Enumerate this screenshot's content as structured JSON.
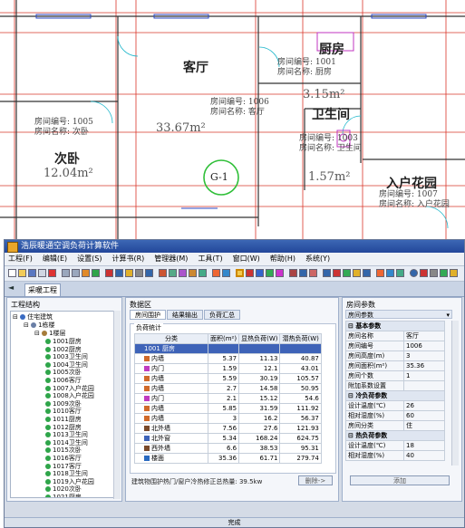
{
  "cad": {
    "rooms": [
      {
        "name": "客厅",
        "area": "33.67m²",
        "number_label": "房间编号: 1006",
        "name_label": "房间名称: 客厅"
      },
      {
        "name": "厨房",
        "number_label": "房间编号: 1001",
        "name_label": "房间名称: 厨房"
      },
      {
        "name": "卫生间",
        "area": "3.15m²",
        "number_label": "房间编号: 1003",
        "name_label": "房间名称: 卫生间"
      },
      {
        "name": "次卧",
        "area": "12.04m²",
        "number_label": "房间编号: 1005",
        "name_label": "房间名称: 次卧"
      },
      {
        "name": "入户花园",
        "area": "1.57m²",
        "number_label": "房间编号: 1007",
        "name_label": "房间名称: 入户花园"
      }
    ],
    "axis_marker": "G-1"
  },
  "app": {
    "title": "浩辰暖通空调负荷计算软件",
    "menu": [
      "工程(F)",
      "编辑(E)",
      "设置(S)",
      "计算书(R)",
      "管理器(M)",
      "工具(T)",
      "窗口(W)",
      "帮助(H)",
      "系统(Y)"
    ],
    "doc_tab": "采暖工程",
    "left_panel": {
      "title": "工程结构",
      "root": "住宅建筑",
      "building": "1栋楼",
      "floor": "1楼层",
      "rooms": [
        "1001厨房",
        "1002厨房",
        "1003卫生间",
        "1004卫生间",
        "1005次卧",
        "1006客厅",
        "1007入户花园",
        "1008入户花园",
        "1009次卧",
        "1010客厅",
        "1011厨房",
        "1012厨房",
        "1013卫生间",
        "1014卫生间",
        "1015次卧",
        "1016客厅",
        "1017客厅",
        "1018卫生间",
        "1019入户花园",
        "1020次卧",
        "1021厨房",
        "1022厨房"
      ]
    },
    "center_panel": {
      "title": "数据区",
      "subtabs": [
        "房间围护",
        "结果输出",
        "负荷汇总"
      ],
      "table_title": "负荷统计",
      "columns": [
        "分类",
        "面积(m²)",
        "显热负荷(W)",
        "潜热负荷(W)"
      ],
      "rows": [
        {
          "name": "1001 厨房",
          "area": "",
          "sensible": "",
          "latent": "",
          "selected": true
        },
        {
          "name": "内墙",
          "area": "5.37",
          "sensible": "11.13",
          "latent": "40.87"
        },
        {
          "name": "内门",
          "area": "1.59",
          "sensible": "12.1",
          "latent": "43.01"
        },
        {
          "name": "内墙",
          "area": "5.59",
          "sensible": "30.19",
          "latent": "105.57"
        },
        {
          "name": "内墙",
          "area": "2.7",
          "sensible": "14.58",
          "latent": "50.95"
        },
        {
          "name": "内门",
          "area": "2.1",
          "sensible": "15.12",
          "latent": "54.6"
        },
        {
          "name": "内墙",
          "area": "5.85",
          "sensible": "31.59",
          "latent": "111.92"
        },
        {
          "name": "内墙",
          "area": "3",
          "sensible": "16.2",
          "latent": "56.37"
        },
        {
          "name": "北外墙",
          "area": "7.56",
          "sensible": "27.6",
          "latent": "121.93"
        },
        {
          "name": "北外窗",
          "area": "5.34",
          "sensible": "168.24",
          "latent": "624.75"
        },
        {
          "name": "西外墙",
          "area": "6.6",
          "sensible": "38.53",
          "latent": "95.31"
        },
        {
          "name": "楼面",
          "area": "35.36",
          "sensible": "61.71",
          "latent": "279.74"
        }
      ],
      "footer_text": "建筑物围护热门/窗户冷热修正总热量: 39.5kw",
      "button_label": "删除->"
    },
    "right_panel": {
      "title": "房间参数",
      "header": "房间参数",
      "sections": [
        {
          "title": "基本参数",
          "rows": [
            [
              "房间名称",
              "客厅"
            ],
            [
              "房间编号",
              "1006"
            ],
            [
              "房间高度(m)",
              "3"
            ],
            [
              "房间面积(m²)",
              "35.36"
            ],
            [
              "房间个数",
              "1"
            ],
            [
              "附加系数设置",
              ""
            ]
          ]
        },
        {
          "title": "冷负荷参数",
          "rows": [
            [
              "设计温度(℃)",
              "26"
            ],
            [
              "相对湿度(%)",
              "60"
            ],
            [
              "房间分类",
              "住"
            ]
          ]
        },
        {
          "title": "热负荷参数",
          "rows": [
            [
              "设计温度(℃)",
              "18"
            ],
            [
              "相对湿度(%)",
              "40"
            ]
          ]
        }
      ],
      "button_label": "添加"
    },
    "status": "完成"
  },
  "colors": {
    "wall_red": "#d9362a",
    "wall_blue": "#2e4ac4",
    "marker_green": "#2fbf38",
    "selection": "#3e63b8"
  }
}
